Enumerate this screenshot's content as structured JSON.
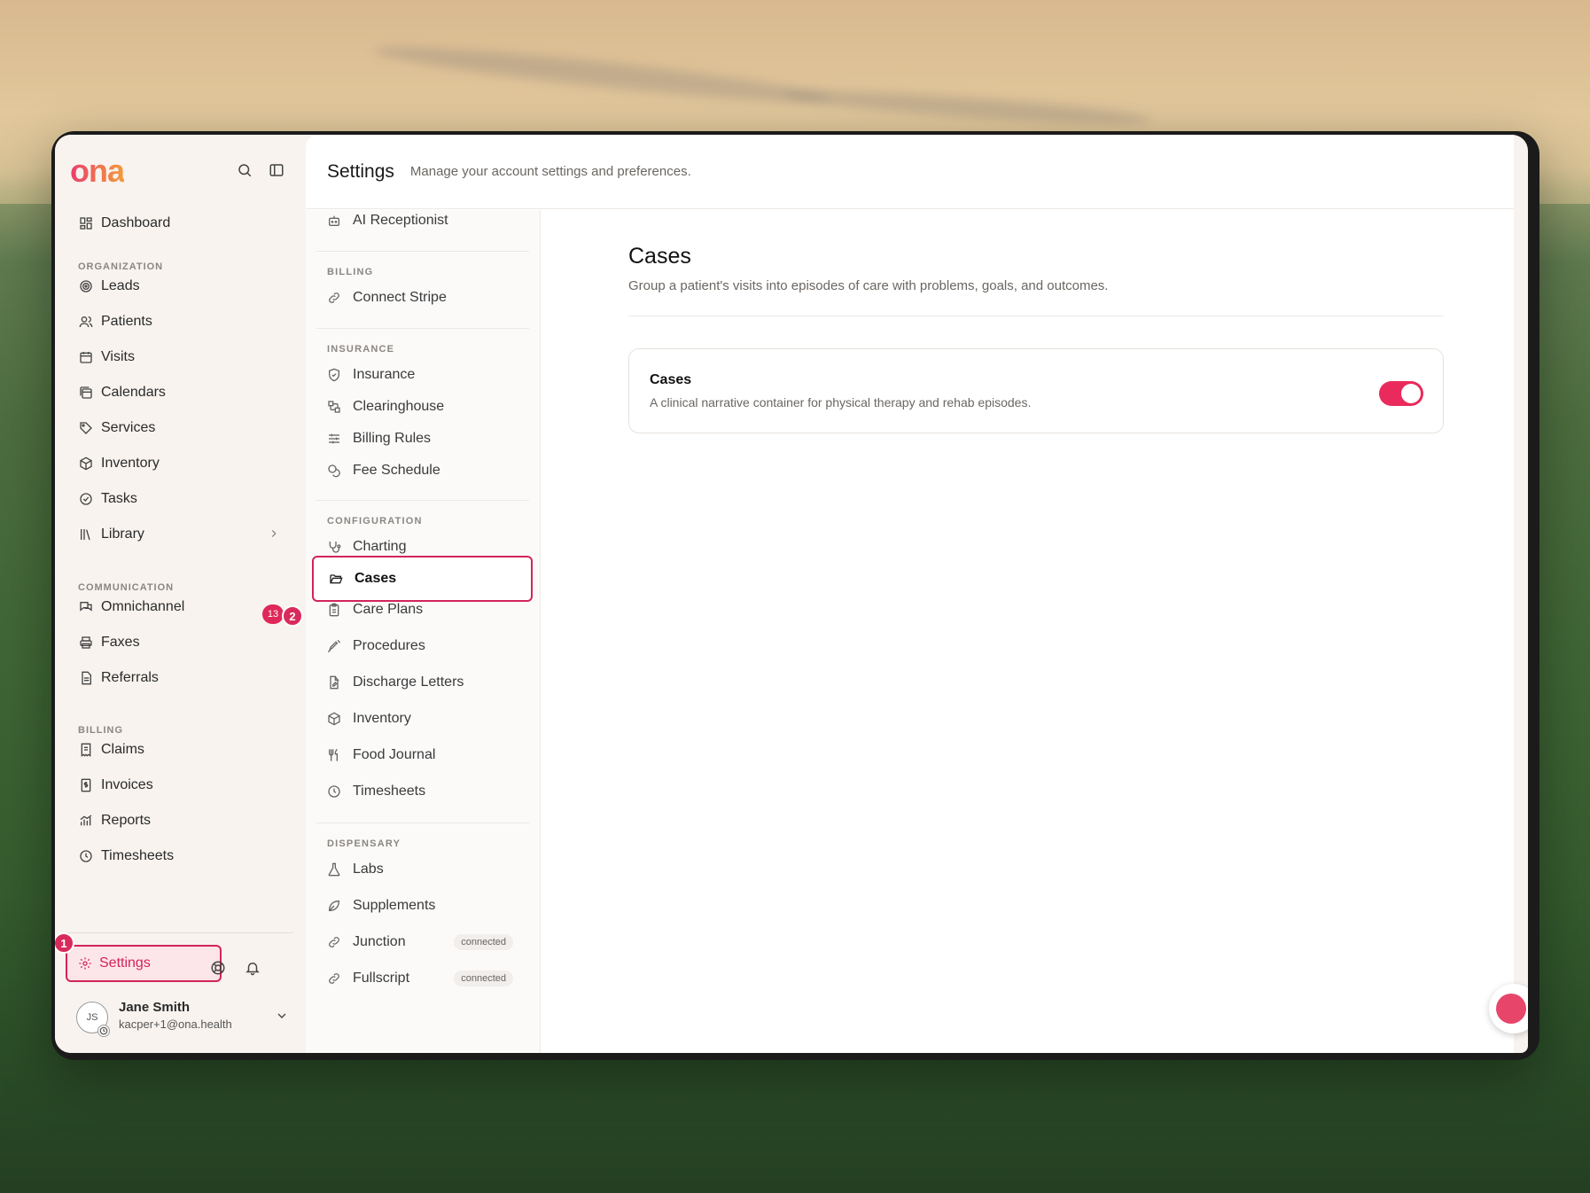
{
  "app": {
    "logo_text": "ona",
    "accent_color": "#d2245a",
    "brand_gradient": [
      "#ea3d6e",
      "#f39a3b"
    ]
  },
  "sidebar": {
    "dashboard_label": "Dashboard",
    "sections": {
      "organization": "ORGANIZATION",
      "communication": "COMMUNICATION",
      "billing": "BILLING"
    },
    "organization_items": [
      {
        "label": "Leads",
        "icon": "target-icon"
      },
      {
        "label": "Patients",
        "icon": "users-icon"
      },
      {
        "label": "Visits",
        "icon": "calendar-icon"
      },
      {
        "label": "Calendars",
        "icon": "calendars-icon"
      },
      {
        "label": "Services",
        "icon": "tag-icon"
      },
      {
        "label": "Inventory",
        "icon": "box-icon"
      },
      {
        "label": "Tasks",
        "icon": "check-circle-icon"
      },
      {
        "label": "Library",
        "icon": "library-icon"
      }
    ],
    "communication_items": [
      {
        "label": "Omnichannel",
        "icon": "chat-icon"
      },
      {
        "label": "Faxes",
        "icon": "printer-icon"
      },
      {
        "label": "Referrals",
        "icon": "document-icon"
      }
    ],
    "billing_items": [
      {
        "label": "Claims",
        "icon": "receipt-icon"
      },
      {
        "label": "Invoices",
        "icon": "invoice-icon"
      },
      {
        "label": "Reports",
        "icon": "chart-icon"
      },
      {
        "label": "Timesheets",
        "icon": "clock-icon"
      }
    ],
    "omnichannel_badge": "13",
    "settings_label": "Settings",
    "step_badges": [
      "1",
      "2"
    ],
    "user": {
      "initials": "JS",
      "name": "Jane Smith",
      "email": "kacper+1@ona.health"
    }
  },
  "header": {
    "title": "Settings",
    "subtitle": "Manage your account settings and preferences."
  },
  "subnav": {
    "top_item": "AI Receptionist",
    "sections": {
      "billing": "BILLING",
      "insurance": "INSURANCE",
      "configuration": "CONFIGURATION",
      "dispensary": "DISPENSARY"
    },
    "billing_items": [
      "Connect Stripe"
    ],
    "insurance_items": [
      "Insurance",
      "Clearinghouse",
      "Billing Rules",
      "Fee Schedule"
    ],
    "configuration_items": [
      "Charting",
      "Cases",
      "Care Plans",
      "Procedures",
      "Discharge Letters",
      "Inventory",
      "Food Journal",
      "Timesheets"
    ],
    "dispensary_items": [
      "Labs",
      "Supplements",
      "Junction",
      "Fullscript"
    ],
    "connected_label": "connected",
    "active_item": "Cases"
  },
  "content": {
    "title": "Cases",
    "description": "Group a patient's visits into episodes of care with problems, goals, and outcomes.",
    "card": {
      "title": "Cases",
      "description": "A clinical narrative container for physical therapy and rehab episodes.",
      "enabled": true
    }
  }
}
